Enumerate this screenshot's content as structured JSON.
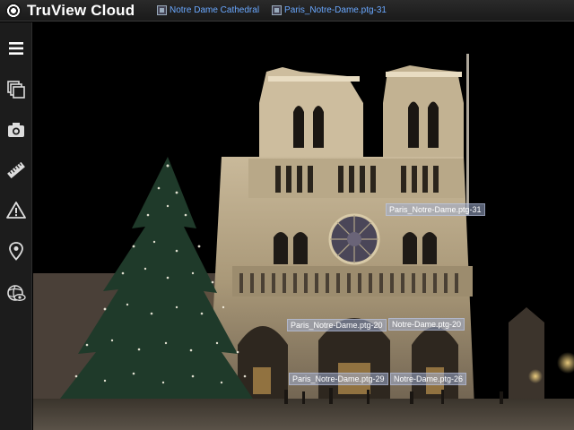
{
  "app": {
    "title": "TruView Cloud"
  },
  "breadcrumbs": [
    {
      "label": "Notre Dame Cathedral",
      "icon": "project-icon"
    },
    {
      "label": "Paris_Notre-Dame.ptg-31",
      "icon": "scan-icon"
    }
  ],
  "sidebar": {
    "tools": [
      {
        "name": "menu",
        "icon": "hamburger-menu-icon"
      },
      {
        "name": "views",
        "icon": "layers-icon"
      },
      {
        "name": "snapshot",
        "icon": "camera-icon"
      },
      {
        "name": "measure",
        "icon": "ruler-icon"
      },
      {
        "name": "markup",
        "icon": "warning-triangle-icon"
      },
      {
        "name": "locations",
        "icon": "map-pin-icon"
      },
      {
        "name": "visibility",
        "icon": "globe-eye-icon"
      }
    ]
  },
  "viewport": {
    "scan_tags": [
      {
        "label": "Paris_Notre-Dame.ptg-31"
      },
      {
        "label": "Paris_Notre-Dame.ptg-20"
      },
      {
        "label": "Notre-Dame.ptg-20"
      },
      {
        "label": "Paris_Notre-Dame.ptg-29"
      },
      {
        "label": "Notre-Dame.ptg-26"
      }
    ]
  },
  "colors": {
    "accent": "#6aa8ff",
    "topbar": "#1a1a1a",
    "sidebar": "#1c1c1c"
  }
}
